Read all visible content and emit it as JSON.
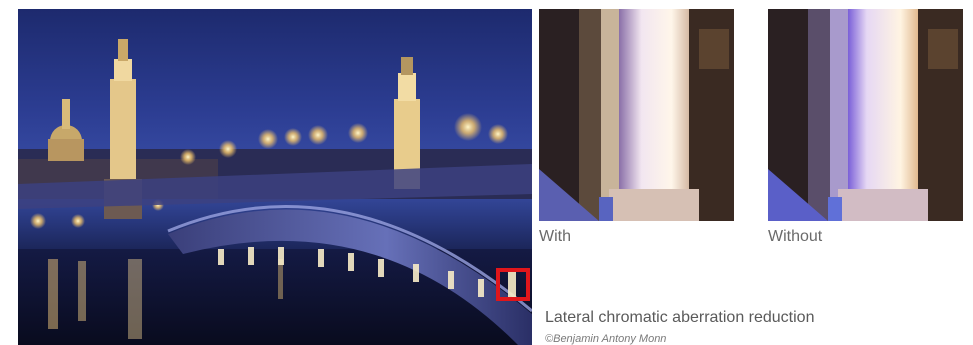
{
  "figure": {
    "crop_with_label": "With",
    "crop_without_label": "Without",
    "caption": "Lateral chromatic aberration reduction",
    "credit": "©Benjamin Antony Monn"
  },
  "colors": {
    "highlight_box": "#e0161b",
    "night_sky": "#2c3d92"
  }
}
